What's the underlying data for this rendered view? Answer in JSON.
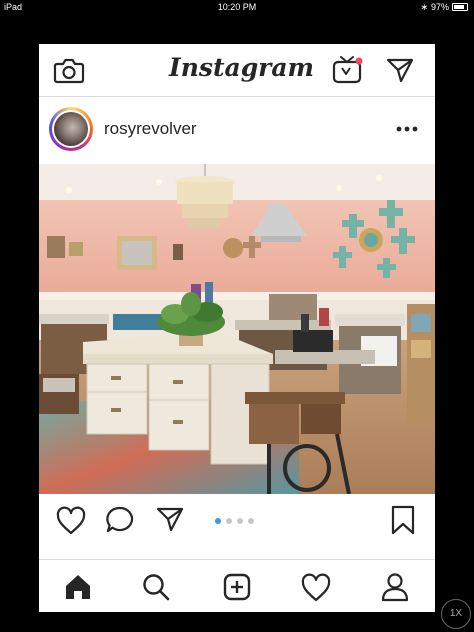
{
  "status_bar": {
    "device": "iPad",
    "time": "10:20 PM",
    "battery": "97%"
  },
  "header": {
    "logo_text": "Instagram",
    "icons": [
      "camera-icon",
      "igtv-icon",
      "direct-message-icon"
    ],
    "igtv_notification_color": "#ed4956"
  },
  "post": {
    "username": "rosyrevolver",
    "more_icon": "more-options-icon",
    "image_alt": "craft room with pink walls, chandelier and wall crosses",
    "carousel": {
      "count": 4,
      "active_index": 0,
      "active_color": "#3897f0"
    }
  },
  "actions": {
    "icons": [
      "heart-icon",
      "comment-icon",
      "share-icon",
      "bookmark-icon"
    ]
  },
  "bottom_nav": {
    "items": [
      "home-icon",
      "search-icon",
      "add-post-icon",
      "activity-heart-icon",
      "profile-icon"
    ]
  },
  "zoom_label": "1X"
}
